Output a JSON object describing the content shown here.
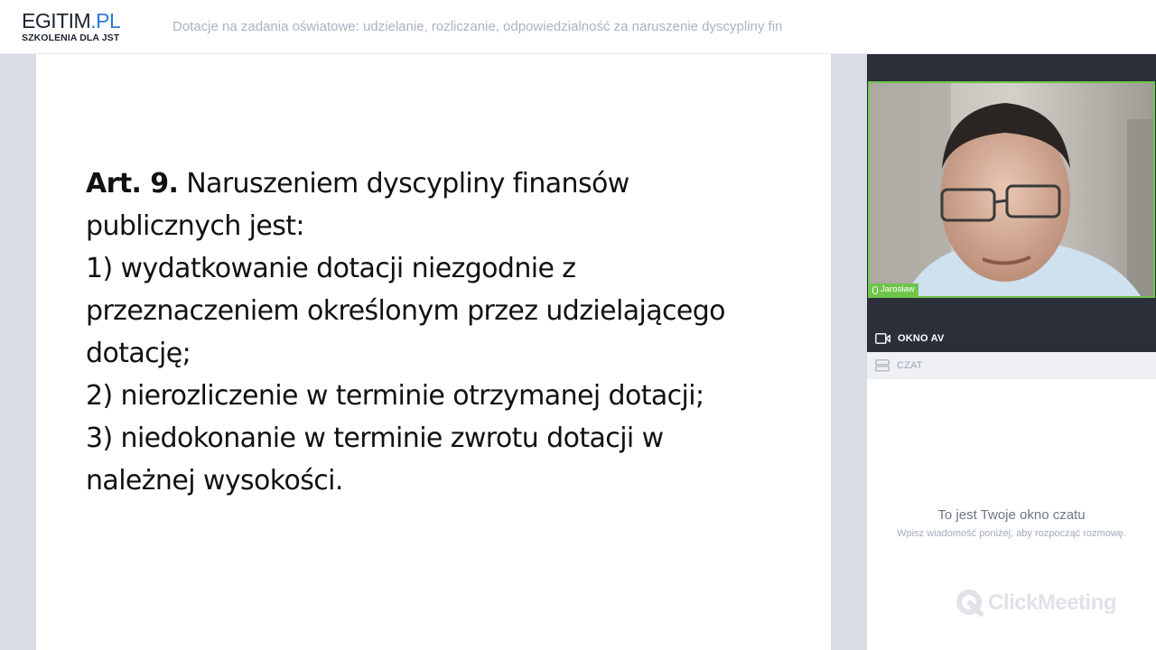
{
  "header": {
    "logo_main": "EGITIM",
    "logo_domain": ".PL",
    "logo_sub": "SZKOLENIA DLA JST",
    "session_title": "Dotacje na zadania oświatowe: udzielanie, rozliczanie, odpowiedzialność za naruszenie dyscypliny fin"
  },
  "slide": {
    "article_label": "Art. 9.",
    "line1_rest": " Naruszeniem dyscypliny finansów",
    "lines": [
      "publicznych jest:",
      "1) wydatkowanie dotacji niezgodnie z",
      "przeznaczeniem określonym przez udzielającego",
      "dotację;",
      "2) nierozliczenie w terminie otrzymanej dotacji;",
      "3) niedokonanie w terminie zwrotu dotacji w",
      "należnej wysokości."
    ]
  },
  "panel": {
    "participant_name": "Jarosław",
    "av_label": "OKNO AV",
    "chat_label": "CZAT",
    "chat_title": "To jest Twoje okno czatu",
    "chat_subtitle": "Wpisz wiadomość poniżej, aby rozpocząć rozmowę.",
    "brand": "ClickMeeting"
  },
  "colors": {
    "accent_green": "#6ec54a",
    "panel_dark": "#2a2f3a",
    "stage_bg": "#d8dce5"
  },
  "icons": [
    "microphone-icon",
    "video-camera-icon",
    "chat-icon",
    "clickmeeting-logo-icon"
  ]
}
